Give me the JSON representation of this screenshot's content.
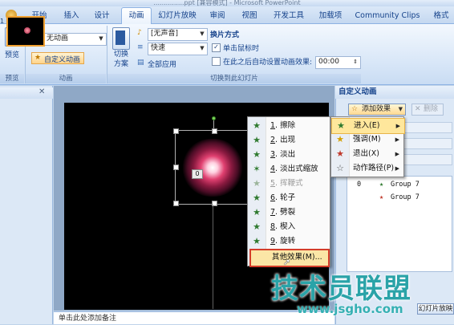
{
  "window": {
    "title": "...............ppt [兼容模式] - Microsoft PowerPoint"
  },
  "tabs": [
    {
      "label": "开始"
    },
    {
      "label": "插入"
    },
    {
      "label": "设计"
    },
    {
      "label": "动画"
    },
    {
      "label": "幻灯片放映"
    },
    {
      "label": "审阅"
    },
    {
      "label": "视图"
    },
    {
      "label": "开发工具"
    },
    {
      "label": "加载项"
    },
    {
      "label": "Community Clips"
    },
    {
      "label": "格式"
    }
  ],
  "ribbon": {
    "preview": {
      "button": "预览",
      "group": "预览"
    },
    "animation": {
      "effect_select": "无动画",
      "custom_button": "自定义动画",
      "group": "动画"
    },
    "transition": {
      "scheme_button": "切换\n方案",
      "sound_select": "[无声音]",
      "speed_select": "快速",
      "apply_all": "全部应用",
      "advance_label": "换片方式",
      "on_click": "单击鼠标时",
      "on_click_checked": true,
      "auto_label": "在此之后自动设置动画效果:",
      "auto_checked": false,
      "auto_time": "00:00",
      "group": "切换到此幻灯片"
    }
  },
  "slide_panel": {
    "slide_number": "1"
  },
  "slide": {
    "shape_tag": "0"
  },
  "notes": {
    "placeholder": "单击此处添加备注"
  },
  "effects_menu": {
    "items": [
      {
        "num": "1",
        "label": "擦除",
        "enabled": true
      },
      {
        "num": "2",
        "label": "出现",
        "enabled": true
      },
      {
        "num": "3",
        "label": "淡出",
        "enabled": true
      },
      {
        "num": "4",
        "label": "淡出式缩放",
        "enabled": true
      },
      {
        "num": "5",
        "label": "挥鞭式",
        "enabled": false
      },
      {
        "num": "6",
        "label": "轮子",
        "enabled": true
      },
      {
        "num": "7",
        "label": "劈裂",
        "enabled": true
      },
      {
        "num": "8",
        "label": "楔入",
        "enabled": true
      },
      {
        "num": "9",
        "label": "旋转",
        "enabled": true
      }
    ],
    "more": "其他效果(M)..."
  },
  "add_effect_menu": {
    "items": [
      {
        "label": "进入(E)",
        "highlighted": true
      },
      {
        "label": "强调(M)",
        "highlighted": false
      },
      {
        "label": "退出(X)",
        "highlighted": false
      },
      {
        "label": "动作路径(P)",
        "highlighted": false
      }
    ]
  },
  "task_pane": {
    "title": "自定义动画",
    "add_effect": "添加效果",
    "delete": "删除",
    "list": [
      {
        "index": "0",
        "name": "Group 7"
      },
      {
        "index": "",
        "name": "Group 7"
      }
    ],
    "play_button": "幻灯片放映"
  },
  "watermark": {
    "text": "技术员联盟",
    "url": "www.jsgho.com"
  },
  "colors": {
    "accent": "#15428b",
    "menu_highlight": "#ffe79c",
    "more_border": "#d43d2a",
    "watermark": "#2aa3a8"
  }
}
